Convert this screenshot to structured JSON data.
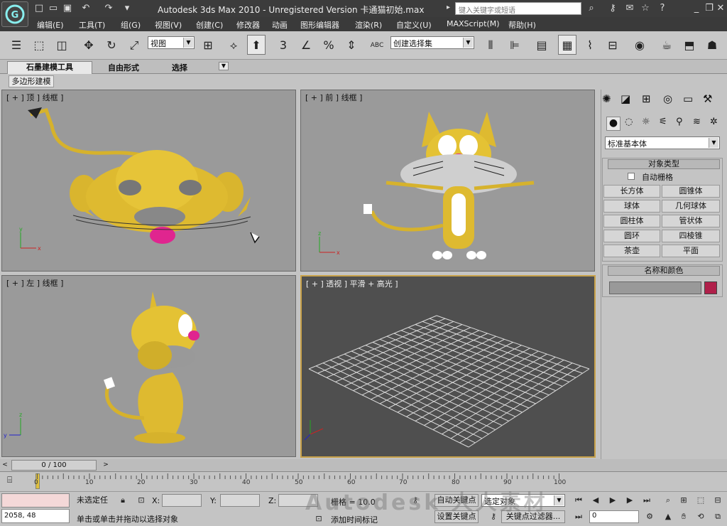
{
  "window": {
    "title": "Autodesk 3ds Max  2010  -  Unregistered Version     卡通猫初始.max",
    "search_placeholder": "键入关键字或短语",
    "logo": "3ds Max logo"
  },
  "menu": [
    "编辑(E)",
    "工具(T)",
    "组(G)",
    "视图(V)",
    "创建(C)",
    "修改器",
    "动画",
    "图形编辑器",
    "渲染(R)",
    "自定义(U)",
    "MAXScript(M)",
    "帮助(H)"
  ],
  "toolbar": {
    "view_select": "视图",
    "selection_set": "创建选择集",
    "abc": "ABC"
  },
  "ribbon": {
    "tabs": [
      "石墨建模工具",
      "自由形式",
      "选择"
    ],
    "subtab": "多边形建模"
  },
  "viewports": {
    "top": "[ + ] 顶 ] 线框 ]",
    "front": "[ + ] 前 ] 线框 ]",
    "left": "[ + ] 左 ] 线框 ]",
    "perspective": "[ + ] 透视 ] 平滑 + 高光 ]"
  },
  "cmdpanel": {
    "category": "标准基本体",
    "object_type": "对象类型",
    "autogrid": "自动栅格",
    "buttons": [
      "长方体",
      "圆锥体",
      "球体",
      "几何球体",
      "圆柱体",
      "管状体",
      "圆环",
      "四棱锥",
      "茶壶",
      "平面"
    ],
    "name_color": "名称和颜色",
    "object_color": "#b0204a"
  },
  "timeline": {
    "frame": "0 / 100",
    "ticks": [
      "0",
      "10",
      "20",
      "30",
      "40",
      "50",
      "60",
      "70",
      "80",
      "90",
      "100"
    ]
  },
  "status": {
    "coords": "2058, 48",
    "selection": "未选定任",
    "x_label": "X:",
    "y_label": "Y:",
    "z_label": "Z:",
    "grid": "栅格 = 10.0",
    "prompt": "单击或单击并拖动以选择对象",
    "add_time_tag": "添加时间标记",
    "auto_key": "自动关键点",
    "set_key": "设置关键点",
    "selected_obj": "选定对象",
    "key_filter": "关键点过滤器...",
    "frame_field": "0"
  },
  "watermark": "Autodesk 人人素材"
}
